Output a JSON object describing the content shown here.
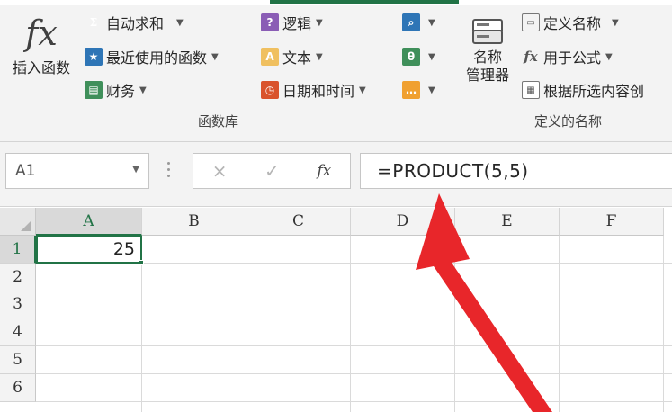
{
  "ribbon": {
    "insert_function": {
      "icon": "fx",
      "label": "插入函数"
    },
    "function_library": {
      "autosum": "自动求和",
      "recent": "最近使用的函数",
      "financial": "财务",
      "logical": "逻辑",
      "text": "文本",
      "datetime": "日期和时间",
      "group_label": "函数库"
    },
    "defined_names": {
      "name_manager_line1": "名称",
      "name_manager_line2": "管理器",
      "define_name": "定义名称",
      "use_in_formula": "用于公式",
      "create_from_selection": "根据所选内容创",
      "group_label": "定义的名称"
    }
  },
  "formula_bar": {
    "name_box": "A1",
    "cancel_symbol": "×",
    "enter_symbol": "✓",
    "fx_symbol": "fx",
    "formula": "=PRODUCT(5,5)"
  },
  "sheet": {
    "columns": [
      "A",
      "B",
      "C",
      "D",
      "E",
      "F"
    ],
    "rows": [
      "1",
      "2",
      "3",
      "4",
      "5",
      "6"
    ],
    "active_cell": "A1",
    "cells": {
      "A1": "25"
    }
  },
  "colors": {
    "accent": "#217346",
    "arrow": "#e8262a"
  }
}
